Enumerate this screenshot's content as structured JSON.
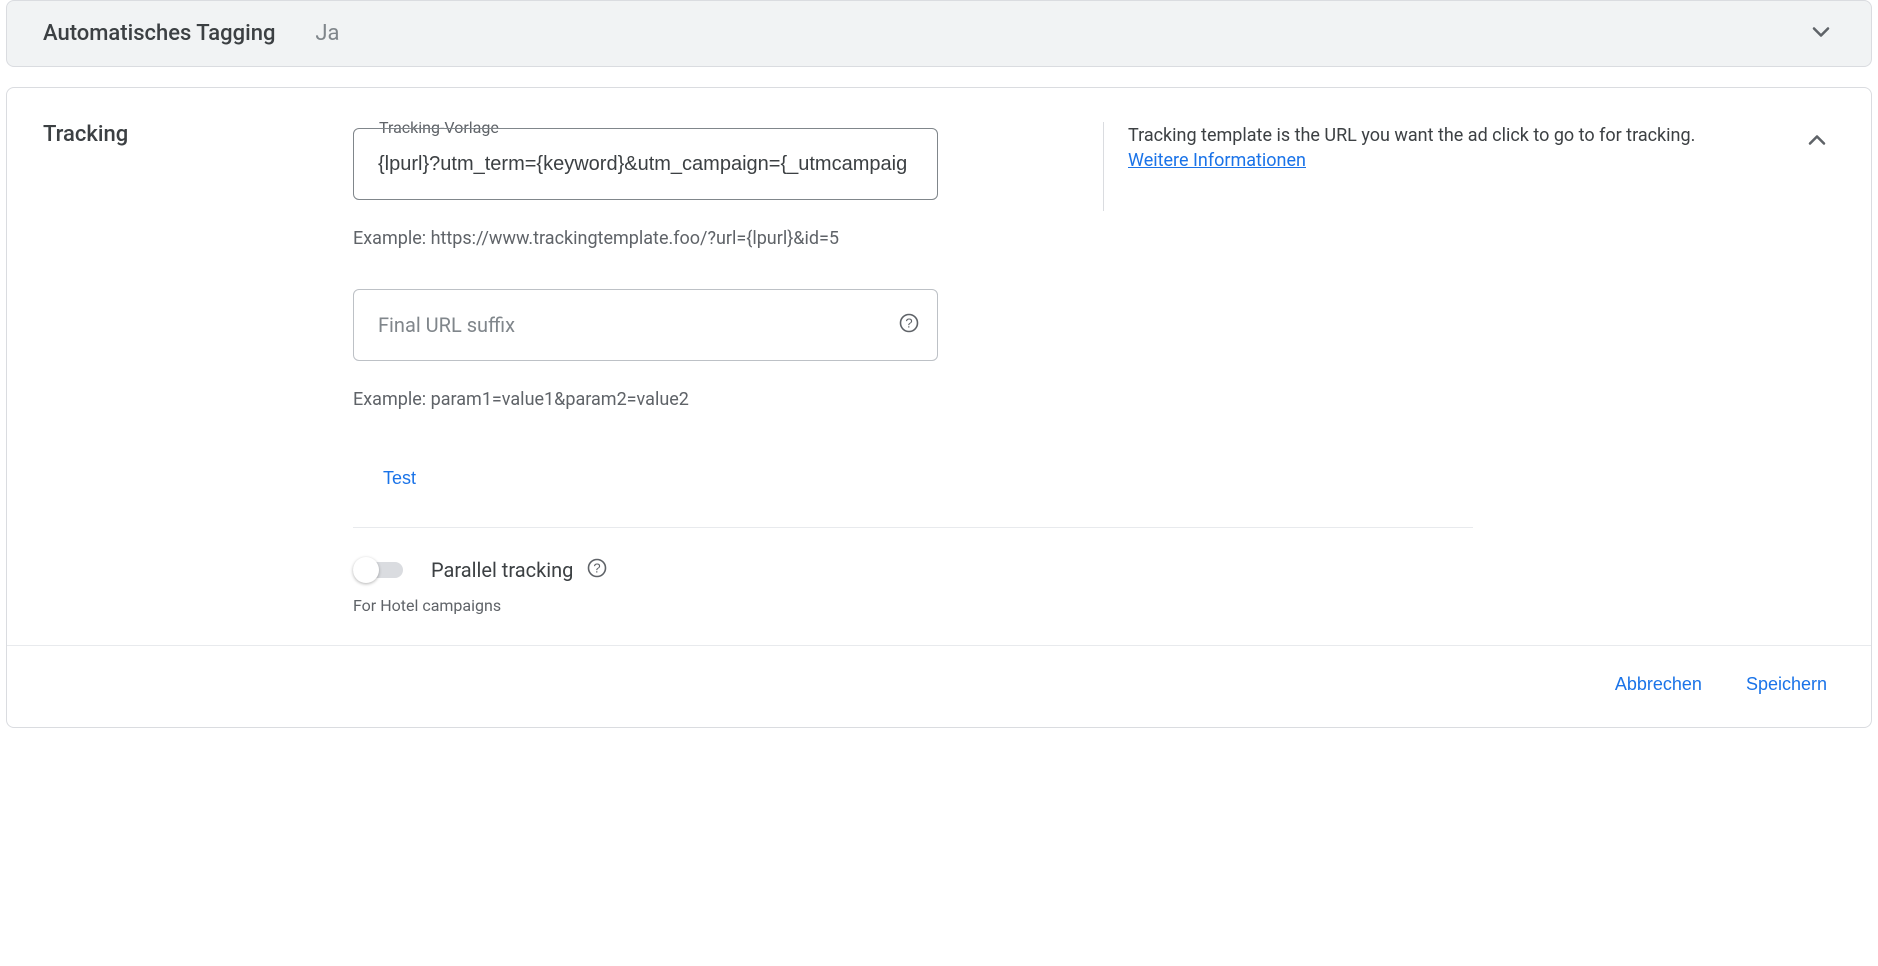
{
  "autotag": {
    "title": "Automatisches Tagging",
    "value": "Ja"
  },
  "tracking": {
    "title": "Tracking",
    "template_field": {
      "label": "Tracking-Vorlage",
      "value": "{lpurl}?utm_term={keyword}&utm_campaign={_utmcampaig",
      "example": "Example: https://www.trackingtemplate.foo/?url={lpurl}&id=5"
    },
    "suffix_field": {
      "placeholder": "Final URL suffix",
      "value": "",
      "example": "Example: param1=value1&param2=value2"
    },
    "test_label": "Test",
    "parallel": {
      "label": "Parallel tracking",
      "sub": "For Hotel campaigns",
      "on": false
    },
    "help": {
      "text": "Tracking template is the URL you want the ad click to go to for tracking.",
      "link_text": "Weitere Informationen"
    },
    "footer": {
      "cancel": "Abbrechen",
      "save": "Speichern"
    }
  }
}
